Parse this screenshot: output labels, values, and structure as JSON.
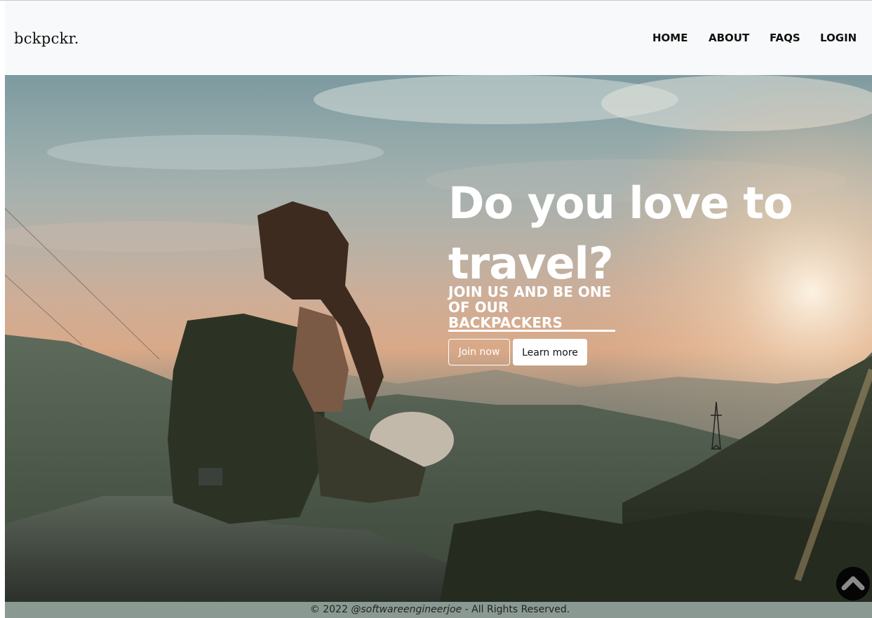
{
  "brand": {
    "name": "bckpckr."
  },
  "nav": {
    "items": [
      {
        "label": "HOME"
      },
      {
        "label": "ABOUT"
      },
      {
        "label": "FAQS"
      },
      {
        "label": "LOGIN"
      }
    ]
  },
  "hero": {
    "headline": "Do you love to travel?",
    "subheading_line1": "JOIN US AND BE ONE OF OUR",
    "subheading_highlight": "BACKPACKERS",
    "join_button": "Join now",
    "learn_button": "Learn more"
  },
  "footer": {
    "prefix": "© 2022 ",
    "handle": "@softwareengineerjoe",
    "suffix": " - All Rights Reserved."
  },
  "scroll_top": {
    "icon": "chevron-up-icon"
  },
  "colors": {
    "navbar_bg": "#f8f9fa",
    "hero_text": "#ffffff",
    "scroll_button": "#050505",
    "footer_bg": "#8a9a93"
  }
}
